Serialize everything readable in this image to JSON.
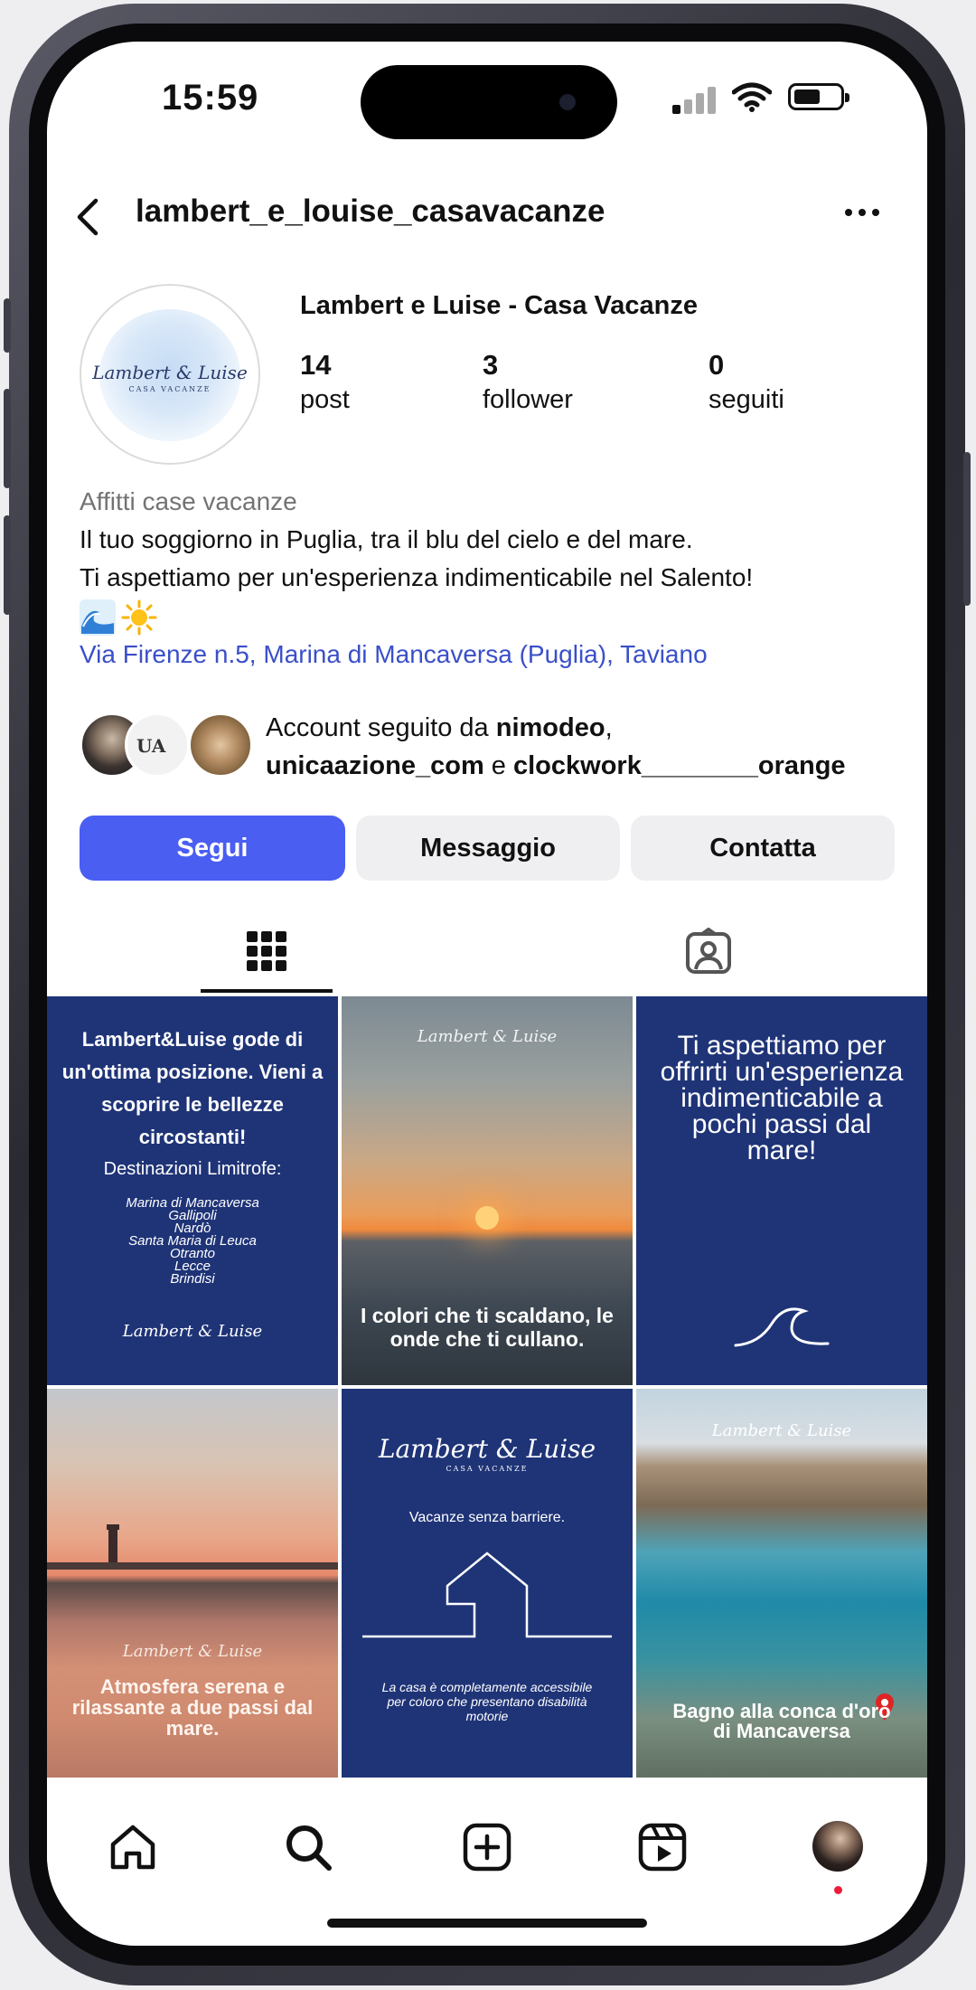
{
  "status_bar": {
    "time": "15:59"
  },
  "header": {
    "username": "lambert_e_louise_casavacanze"
  },
  "profile": {
    "display_name": "Lambert e Luise - Casa Vacanze",
    "avatar_logo_text": "Lambert & Luise",
    "avatar_logo_sub": "CASA VACANZE",
    "stats": [
      {
        "value": "14",
        "label": "post"
      },
      {
        "value": "3",
        "label": "follower"
      },
      {
        "value": "0",
        "label": "seguiti"
      }
    ],
    "category": "Affitti case vacanze",
    "bio_line1": "Il tuo soggiorno in Puglia, tra il blu del cielo e del mare.",
    "bio_line2": "Ti aspettiamo per un'esperienza indimenticabile nel Salento!",
    "address": "Via Firenze n.5, Marina di Mancaversa (Puglia), Taviano"
  },
  "followed_by": {
    "prefix": "Account seguito da ",
    "user1": "nimodeo",
    "sep1": ",",
    "user2": "unicaazione_com",
    "and": " e ",
    "user3": "clockwork________orange",
    "avatar2_text": "UA"
  },
  "buttons": {
    "follow": "Segui",
    "message": "Messaggio",
    "contact": "Contatta"
  },
  "posts": {
    "p1": {
      "title": "Lambert&Luise gode di un'ottima posizione. Vieni a scoprire le bellezze circostanti!",
      "subtitle": "Destinazioni Limitrofe:",
      "places": [
        "Marina di Mancaversa",
        "Gallipoli",
        "Nardò",
        "Santa Maria di Leuca",
        "Otranto",
        "Lecce",
        "Brindisi"
      ],
      "brand": "Lambert & Luise"
    },
    "p2": {
      "brand": "Lambert & Luise",
      "caption": "I colori che ti scaldano, le onde che ti cullano."
    },
    "p3": {
      "text": "Ti aspettiamo per offrirti un'esperienza indimenticabile a pochi passi dal mare!"
    },
    "p4": {
      "brand": "Lambert & Luise",
      "caption": "Atmosfera serena e rilassante a due passi dal mare."
    },
    "p5": {
      "brand": "Lambert & Luise",
      "brand_sub": "CASA VACANZE",
      "tagline": "Vacanze senza barriere.",
      "body": "La casa è completamente accessibile per coloro che presentano disabilità motorie"
    },
    "p6": {
      "brand": "Lambert & Luise",
      "caption": "Bagno alla conca d'oro di Mancaversa"
    }
  },
  "colors": {
    "accent": "#4a5ef2",
    "link": "#3a4fc9",
    "post_navy": "#1f3477"
  },
  "icons": [
    "back-icon",
    "more-icon",
    "grid-icon",
    "tagged-icon",
    "home-icon",
    "search-icon",
    "create-icon",
    "reels-icon",
    "profile-avatar-icon"
  ]
}
